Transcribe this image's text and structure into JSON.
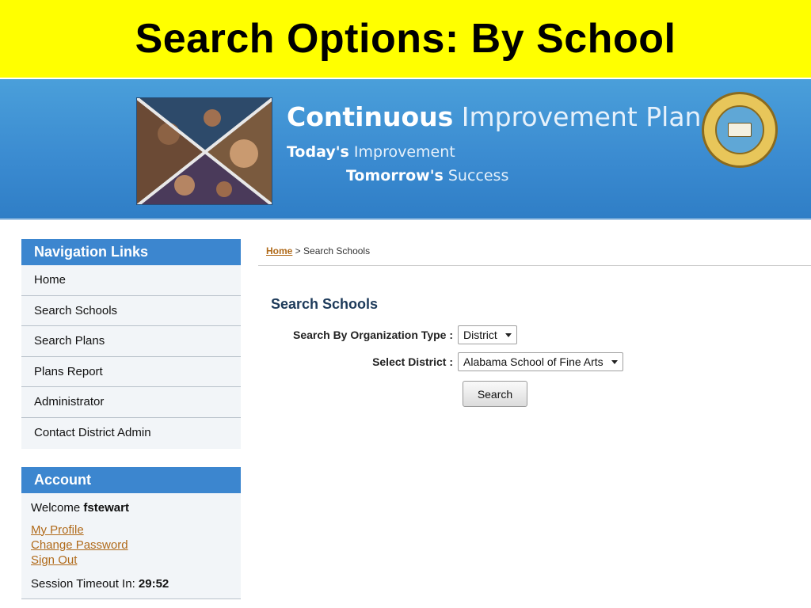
{
  "slide": {
    "title": "Search Options: By School"
  },
  "banner": {
    "title_bold": "Continuous",
    "title_light": "Improvement Plan",
    "tagline1_bold": "Today's",
    "tagline1_light": "Improvement",
    "tagline2_bold": "Tomorrow's",
    "tagline2_light": "Success",
    "seal_icon": "state-seal-icon",
    "photo_icon": "student-collage-image"
  },
  "sidebar": {
    "nav_heading": "Navigation Links",
    "items": [
      {
        "label": "Home"
      },
      {
        "label": "Search Schools"
      },
      {
        "label": "Search Plans"
      },
      {
        "label": "Plans Report"
      },
      {
        "label": "Administrator"
      },
      {
        "label": "Contact District Admin"
      }
    ],
    "account_heading": "Account",
    "welcome_prefix": "Welcome",
    "username": "fstewart",
    "links": {
      "profile": "My Profile",
      "change_password": "Change Password",
      "sign_out": "Sign Out"
    },
    "timeout_label": "Session Timeout In:",
    "timeout_value": "29:52"
  },
  "main": {
    "breadcrumb_home": "Home",
    "breadcrumb_sep": " > ",
    "breadcrumb_current": "Search Schools",
    "section_title": "Search Schools",
    "org_type_label": "Search By Organization Type :",
    "org_type_value": "District",
    "district_label": "Select District :",
    "district_value": "Alabama School of Fine Arts",
    "search_button": "Search"
  },
  "colors": {
    "title_band": "#ffff00",
    "banner": "#3a8ad0",
    "panel_head": "#3c86cf",
    "link": "#b06a1a"
  }
}
